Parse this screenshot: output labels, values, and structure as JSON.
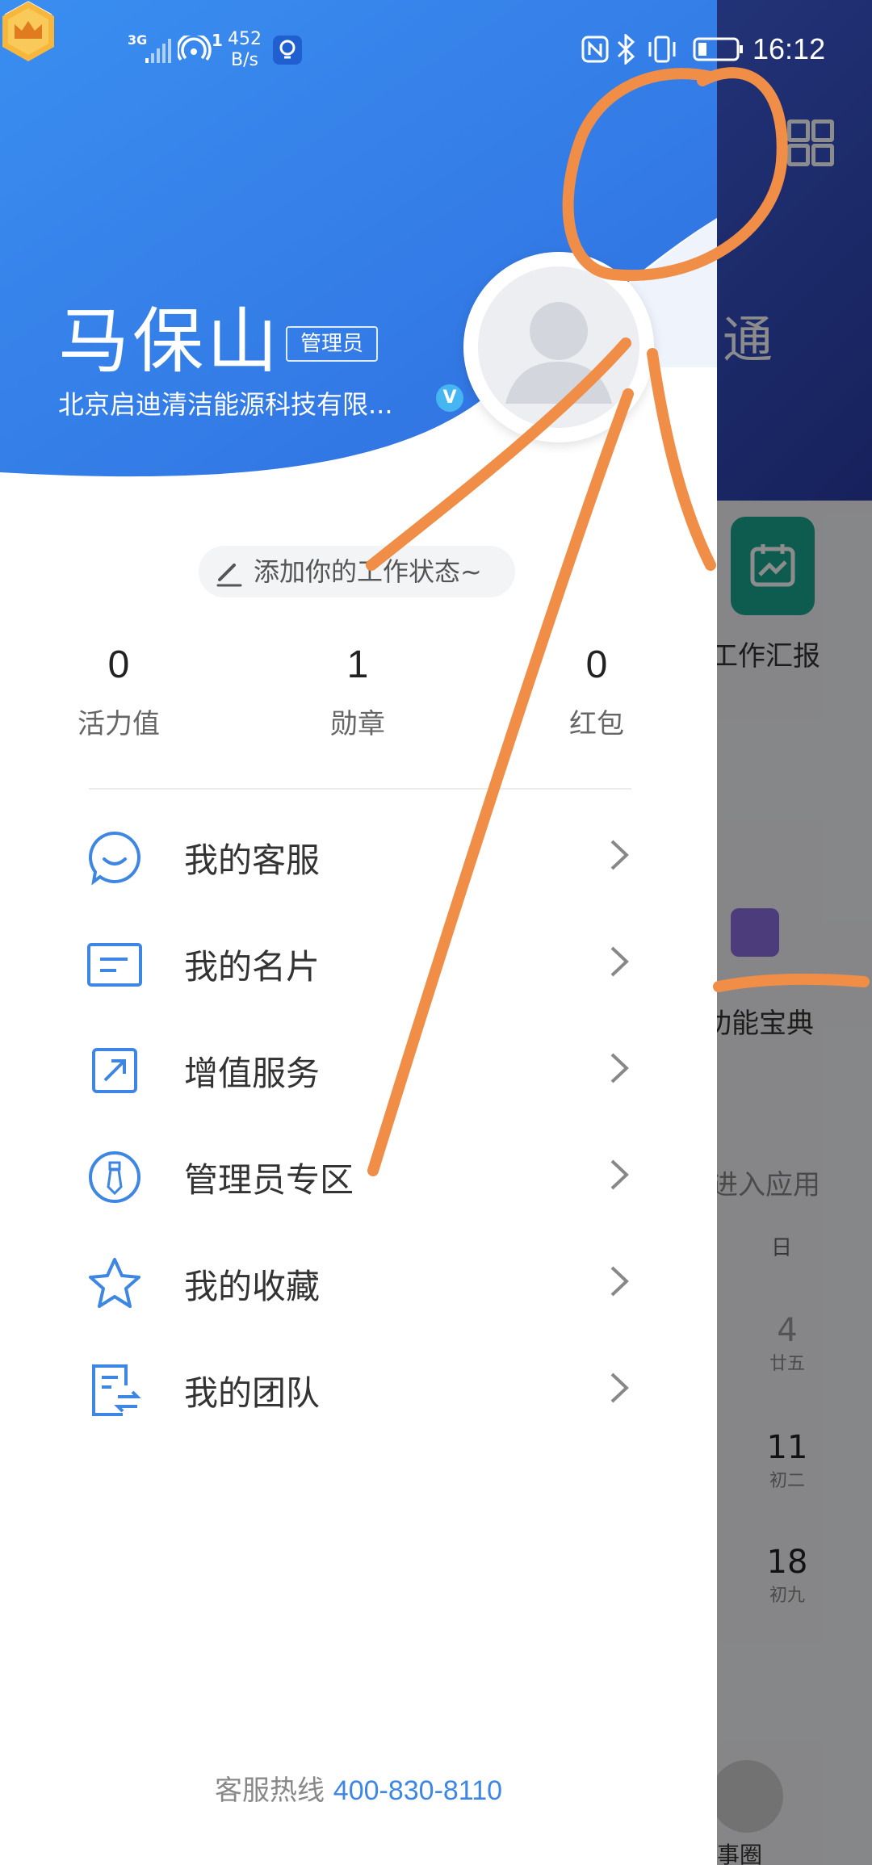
{
  "status_bar": {
    "network": "3G",
    "hotspot_count": "1",
    "speed_value": "452",
    "speed_unit": "B/s",
    "time": "16:12",
    "icons": [
      "signal-icon",
      "hotspot-icon",
      "bulb-icon",
      "nfc-icon",
      "bluetooth-icon",
      "vibrate-icon",
      "battery-icon"
    ]
  },
  "background_app": {
    "title_fragment": "通",
    "tile_label": "工作汇报",
    "book_label": "功能宝典",
    "enter_apps": "进入应用",
    "calendar_header": "日",
    "days": [
      {
        "num": "4",
        "lunar": "廿五"
      },
      {
        "num": "11",
        "lunar": "初二"
      },
      {
        "num": "18",
        "lunar": "初九"
      }
    ],
    "bottom_label": "事圈"
  },
  "drawer": {
    "settings_icon": "settings-icon",
    "user": {
      "name": "马保山",
      "role_badge": "管理员",
      "company": "北京启迪清洁能源科技有限...",
      "verified_mark": "V"
    },
    "status_prompt": "添加你的工作状态~",
    "stats": [
      {
        "value": "0",
        "label": "活力值"
      },
      {
        "value": "1",
        "label": "勋章"
      },
      {
        "value": "0",
        "label": "红包"
      }
    ],
    "menu": [
      {
        "label": "我的客服",
        "icon": "customer-service-icon"
      },
      {
        "label": "我的名片",
        "icon": "business-card-icon"
      },
      {
        "label": "增值服务",
        "icon": "value-added-icon"
      },
      {
        "label": "管理员专区",
        "icon": "admin-tie-icon"
      },
      {
        "label": "我的收藏",
        "icon": "star-icon"
      },
      {
        "label": "我的团队",
        "icon": "team-icon"
      }
    ],
    "hotline_label": "客服热线",
    "hotline_number": "400-830-8110"
  },
  "colors": {
    "header_blue": "#3d86ef",
    "accent_blue": "#3e86e4",
    "annotation_orange": "#f08d46"
  }
}
